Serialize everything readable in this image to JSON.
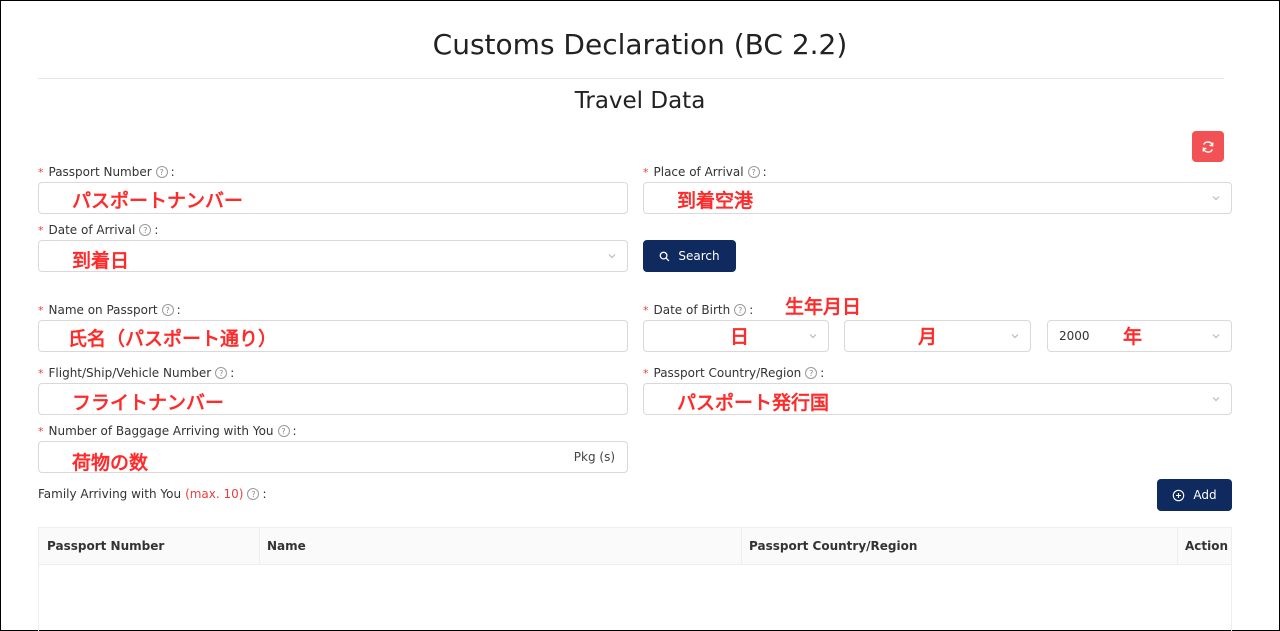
{
  "page": {
    "title": "Customs Declaration (BC 2.2)",
    "section_title": "Travel Data"
  },
  "labels": {
    "passport_number": "Passport Number",
    "place_of_arrival": "Place of Arrival",
    "date_of_arrival": "Date of Arrival",
    "name_on_passport": "Name on Passport",
    "date_of_birth": "Date of Birth",
    "flight_number": "Flight/Ship/Vehicle Number",
    "passport_country": "Passport Country/Region",
    "baggage": "Number of Baggage Arriving with You",
    "family": "Family Arriving with You",
    "family_max": "(max. 10)",
    "required_mark": "*",
    "colon": ":"
  },
  "fields": {
    "dob_year_value": "2000",
    "baggage_unit": "Pkg (s)"
  },
  "buttons": {
    "search": "Search",
    "add": "Add"
  },
  "annotations": {
    "passport_number": "パスポートナンバー",
    "place_of_arrival": "到着空港",
    "date_of_arrival": "到着日",
    "date_of_birth": "生年月日",
    "name_on_passport": "氏名（パスポート通り）",
    "dob_day": "日",
    "dob_month": "月",
    "dob_year": "年",
    "flight_number": "フライトナンバー",
    "passport_country": "パスポート発行国",
    "baggage": "荷物の数"
  },
  "table": {
    "headers": [
      "Passport Number",
      "Name",
      "Passport Country/Region",
      "Action"
    ]
  },
  "colors": {
    "primary": "#0e2a5e",
    "refresh": "#f25253",
    "required": "#e84040",
    "annotation": "#ff2a2a"
  },
  "icons": {
    "refresh": "refresh-icon",
    "search": "search-icon",
    "add": "plus-circle-icon",
    "help": "question-circle-icon",
    "dropdown": "chevron-down-icon"
  }
}
